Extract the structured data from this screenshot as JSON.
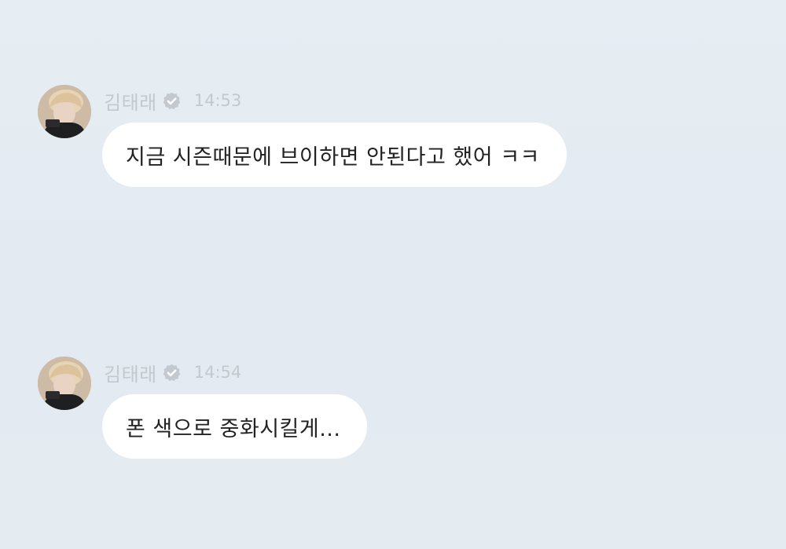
{
  "messages": [
    {
      "sender": "김태래",
      "time": "14:53",
      "text": "지금 시즌때문에 브이하면 안된다고 했어 ㅋㅋ"
    },
    {
      "sender": "김태래",
      "time": "14:54",
      "text": "폰 색으로 중화시킬게..."
    }
  ],
  "colors": {
    "background": "#e4ebf1",
    "bubble": "#ffffff",
    "meta_text": "#c3c9cf",
    "message_text": "#222222"
  },
  "icons": {
    "verified": "verified-badge-icon"
  }
}
